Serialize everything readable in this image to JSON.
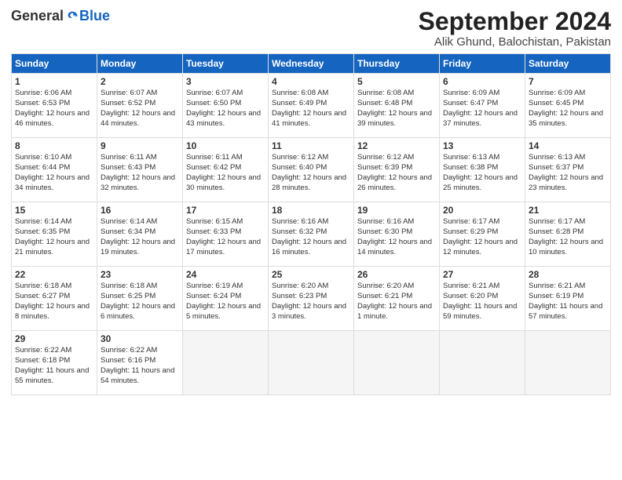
{
  "header": {
    "logo_general": "General",
    "logo_blue": "Blue",
    "month_title": "September 2024",
    "location": "Alik Ghund, Balochistan, Pakistan"
  },
  "days_of_week": [
    "Sunday",
    "Monday",
    "Tuesday",
    "Wednesday",
    "Thursday",
    "Friday",
    "Saturday"
  ],
  "weeks": [
    [
      {
        "day": "1",
        "sunrise": "Sunrise: 6:06 AM",
        "sunset": "Sunset: 6:53 PM",
        "daylight": "Daylight: 12 hours and 46 minutes."
      },
      {
        "day": "2",
        "sunrise": "Sunrise: 6:07 AM",
        "sunset": "Sunset: 6:52 PM",
        "daylight": "Daylight: 12 hours and 44 minutes."
      },
      {
        "day": "3",
        "sunrise": "Sunrise: 6:07 AM",
        "sunset": "Sunset: 6:50 PM",
        "daylight": "Daylight: 12 hours and 43 minutes."
      },
      {
        "day": "4",
        "sunrise": "Sunrise: 6:08 AM",
        "sunset": "Sunset: 6:49 PM",
        "daylight": "Daylight: 12 hours and 41 minutes."
      },
      {
        "day": "5",
        "sunrise": "Sunrise: 6:08 AM",
        "sunset": "Sunset: 6:48 PM",
        "daylight": "Daylight: 12 hours and 39 minutes."
      },
      {
        "day": "6",
        "sunrise": "Sunrise: 6:09 AM",
        "sunset": "Sunset: 6:47 PM",
        "daylight": "Daylight: 12 hours and 37 minutes."
      },
      {
        "day": "7",
        "sunrise": "Sunrise: 6:09 AM",
        "sunset": "Sunset: 6:45 PM",
        "daylight": "Daylight: 12 hours and 35 minutes."
      }
    ],
    [
      {
        "day": "8",
        "sunrise": "Sunrise: 6:10 AM",
        "sunset": "Sunset: 6:44 PM",
        "daylight": "Daylight: 12 hours and 34 minutes."
      },
      {
        "day": "9",
        "sunrise": "Sunrise: 6:11 AM",
        "sunset": "Sunset: 6:43 PM",
        "daylight": "Daylight: 12 hours and 32 minutes."
      },
      {
        "day": "10",
        "sunrise": "Sunrise: 6:11 AM",
        "sunset": "Sunset: 6:42 PM",
        "daylight": "Daylight: 12 hours and 30 minutes."
      },
      {
        "day": "11",
        "sunrise": "Sunrise: 6:12 AM",
        "sunset": "Sunset: 6:40 PM",
        "daylight": "Daylight: 12 hours and 28 minutes."
      },
      {
        "day": "12",
        "sunrise": "Sunrise: 6:12 AM",
        "sunset": "Sunset: 6:39 PM",
        "daylight": "Daylight: 12 hours and 26 minutes."
      },
      {
        "day": "13",
        "sunrise": "Sunrise: 6:13 AM",
        "sunset": "Sunset: 6:38 PM",
        "daylight": "Daylight: 12 hours and 25 minutes."
      },
      {
        "day": "14",
        "sunrise": "Sunrise: 6:13 AM",
        "sunset": "Sunset: 6:37 PM",
        "daylight": "Daylight: 12 hours and 23 minutes."
      }
    ],
    [
      {
        "day": "15",
        "sunrise": "Sunrise: 6:14 AM",
        "sunset": "Sunset: 6:35 PM",
        "daylight": "Daylight: 12 hours and 21 minutes."
      },
      {
        "day": "16",
        "sunrise": "Sunrise: 6:14 AM",
        "sunset": "Sunset: 6:34 PM",
        "daylight": "Daylight: 12 hours and 19 minutes."
      },
      {
        "day": "17",
        "sunrise": "Sunrise: 6:15 AM",
        "sunset": "Sunset: 6:33 PM",
        "daylight": "Daylight: 12 hours and 17 minutes."
      },
      {
        "day": "18",
        "sunrise": "Sunrise: 6:16 AM",
        "sunset": "Sunset: 6:32 PM",
        "daylight": "Daylight: 12 hours and 16 minutes."
      },
      {
        "day": "19",
        "sunrise": "Sunrise: 6:16 AM",
        "sunset": "Sunset: 6:30 PM",
        "daylight": "Daylight: 12 hours and 14 minutes."
      },
      {
        "day": "20",
        "sunrise": "Sunrise: 6:17 AM",
        "sunset": "Sunset: 6:29 PM",
        "daylight": "Daylight: 12 hours and 12 minutes."
      },
      {
        "day": "21",
        "sunrise": "Sunrise: 6:17 AM",
        "sunset": "Sunset: 6:28 PM",
        "daylight": "Daylight: 12 hours and 10 minutes."
      }
    ],
    [
      {
        "day": "22",
        "sunrise": "Sunrise: 6:18 AM",
        "sunset": "Sunset: 6:27 PM",
        "daylight": "Daylight: 12 hours and 8 minutes."
      },
      {
        "day": "23",
        "sunrise": "Sunrise: 6:18 AM",
        "sunset": "Sunset: 6:25 PM",
        "daylight": "Daylight: 12 hours and 6 minutes."
      },
      {
        "day": "24",
        "sunrise": "Sunrise: 6:19 AM",
        "sunset": "Sunset: 6:24 PM",
        "daylight": "Daylight: 12 hours and 5 minutes."
      },
      {
        "day": "25",
        "sunrise": "Sunrise: 6:20 AM",
        "sunset": "Sunset: 6:23 PM",
        "daylight": "Daylight: 12 hours and 3 minutes."
      },
      {
        "day": "26",
        "sunrise": "Sunrise: 6:20 AM",
        "sunset": "Sunset: 6:21 PM",
        "daylight": "Daylight: 12 hours and 1 minute."
      },
      {
        "day": "27",
        "sunrise": "Sunrise: 6:21 AM",
        "sunset": "Sunset: 6:20 PM",
        "daylight": "Daylight: 11 hours and 59 minutes."
      },
      {
        "day": "28",
        "sunrise": "Sunrise: 6:21 AM",
        "sunset": "Sunset: 6:19 PM",
        "daylight": "Daylight: 11 hours and 57 minutes."
      }
    ],
    [
      {
        "day": "29",
        "sunrise": "Sunrise: 6:22 AM",
        "sunset": "Sunset: 6:18 PM",
        "daylight": "Daylight: 11 hours and 55 minutes."
      },
      {
        "day": "30",
        "sunrise": "Sunrise: 6:22 AM",
        "sunset": "Sunset: 6:16 PM",
        "daylight": "Daylight: 11 hours and 54 minutes."
      },
      null,
      null,
      null,
      null,
      null
    ]
  ]
}
